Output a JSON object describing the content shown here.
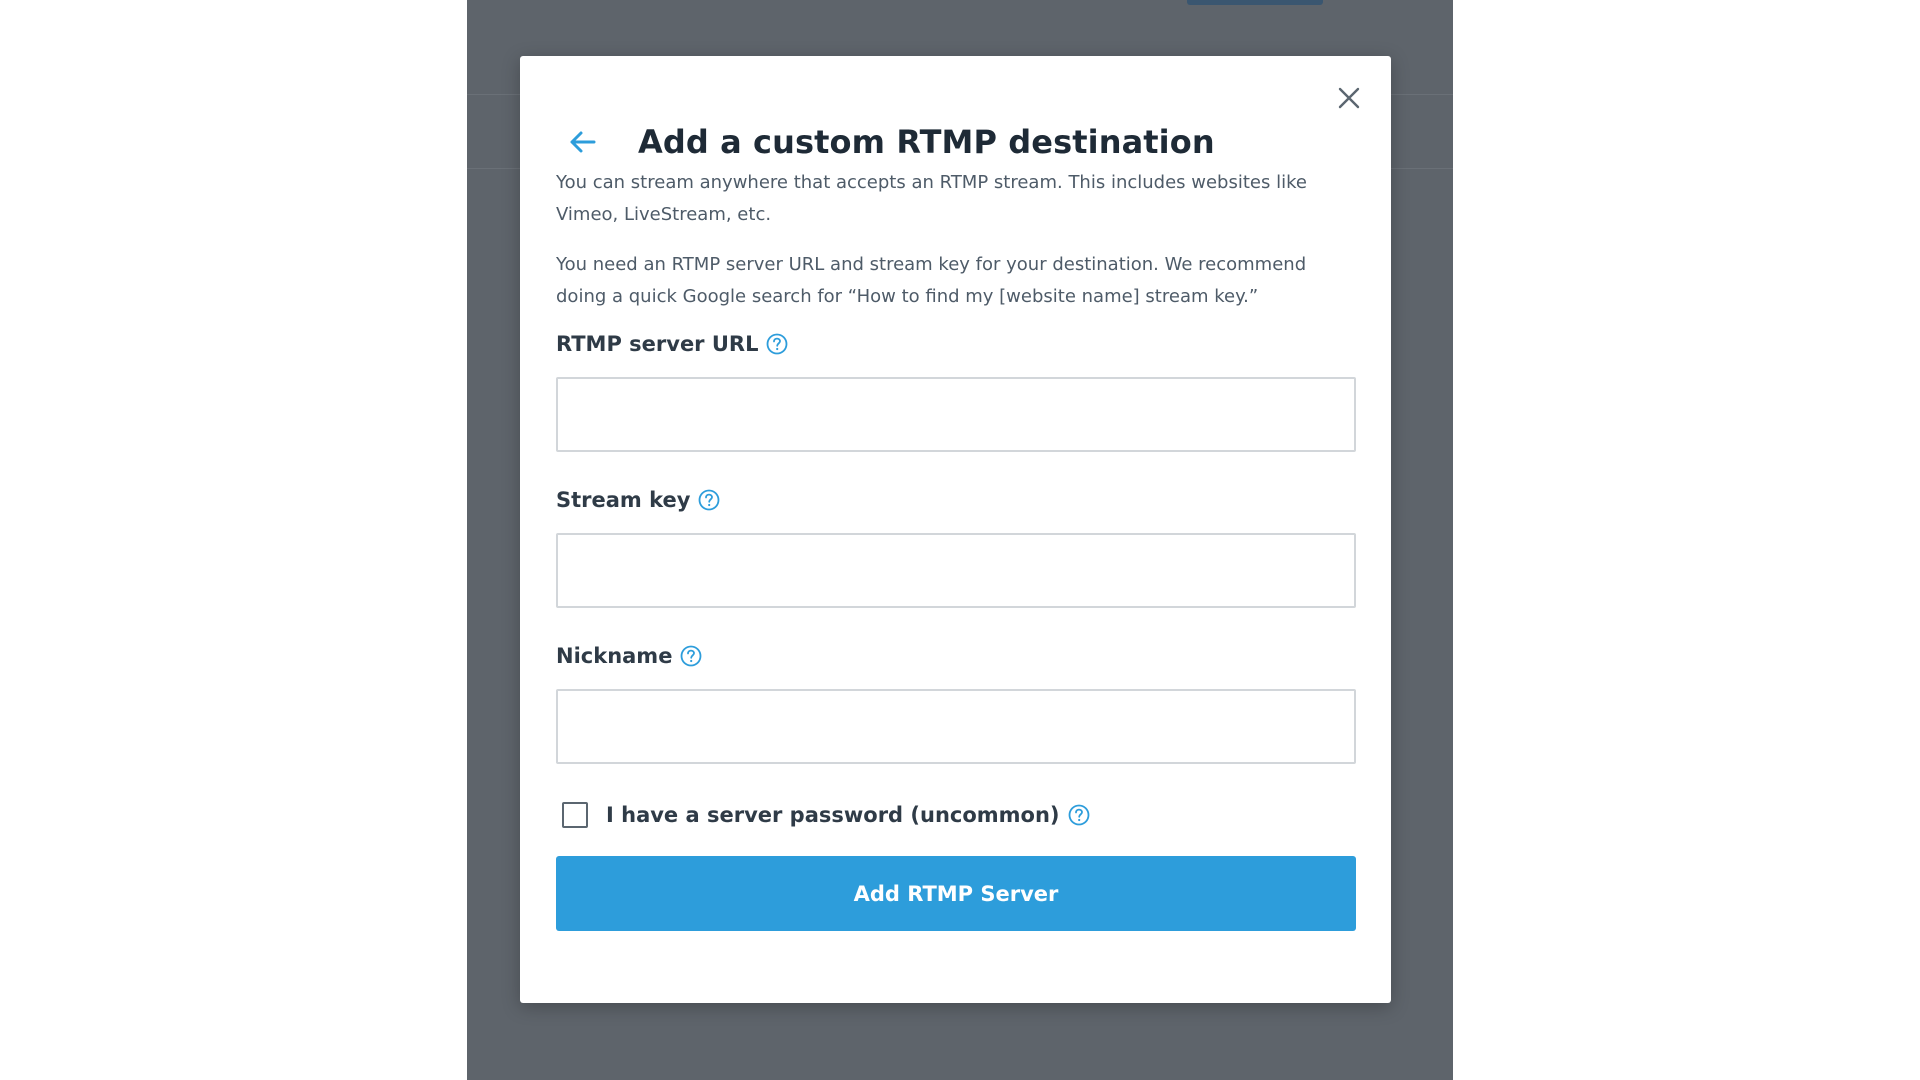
{
  "modal": {
    "title": "Add a custom RTMP destination",
    "description_1": "You can stream anywhere that accepts an RTMP stream. This includes websites like Vimeo, LiveStream, etc.",
    "description_2": "You need an RTMP server URL and stream key for your destination. We recommend doing a quick Google search for “How to find my [website name] stream key.”"
  },
  "fields": {
    "server_url": {
      "label": "RTMP server URL",
      "value": "",
      "placeholder": ""
    },
    "stream_key": {
      "label": "Stream key",
      "value": "",
      "placeholder": ""
    },
    "nickname": {
      "label": "Nickname",
      "value": "",
      "placeholder": ""
    }
  },
  "password_option": {
    "label": "I have a server password (uncommon)",
    "checked": false
  },
  "submit": {
    "label": "Add RTMP Server"
  },
  "icons": {
    "back": "arrow-left-icon",
    "close": "close-icon",
    "help": "question-circle-icon"
  },
  "colors": {
    "accent": "#2d9ddb",
    "overlay": "#5e646b",
    "title": "#1e2a36",
    "body_text": "#4e5b68"
  }
}
